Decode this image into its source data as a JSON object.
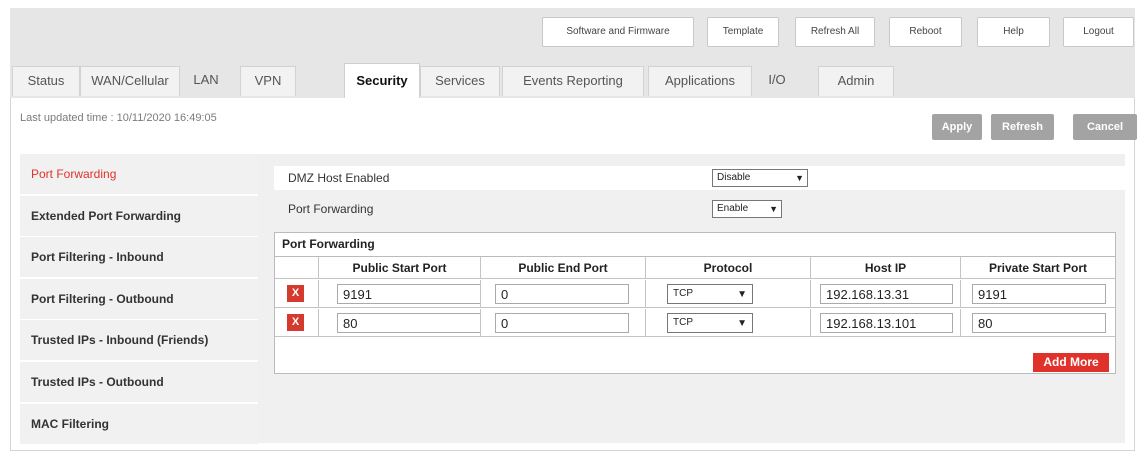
{
  "colors": {
    "accent_red": "#e0322b",
    "delete_red": "#d53a2f",
    "band_gray": "#e6e6e6",
    "panel_gray": "#f0f0f0",
    "action_gray": "#a3a3a3"
  },
  "top_buttons": {
    "software": "Software and Firmware",
    "template": "Template",
    "refresh_all": "Refresh All",
    "reboot": "Reboot",
    "help": "Help",
    "logout": "Logout"
  },
  "tabs": {
    "status": "Status",
    "wan": "WAN/Cellular",
    "lan": "LAN",
    "vpn": "VPN",
    "security": "Security",
    "services": "Services",
    "events": "Events Reporting",
    "applications": "Applications",
    "io": "I/O",
    "admin": "Admin",
    "active": "Security"
  },
  "last_updated": "Last updated time : 10/11/2020 16:49:05",
  "actions": {
    "apply": "Apply",
    "refresh": "Refresh",
    "cancel": "Cancel"
  },
  "sidebar": {
    "items": [
      "Port Forwarding",
      "Extended Port Forwarding",
      "Port Filtering - Inbound",
      "Port Filtering - Outbound",
      "Trusted IPs - Inbound (Friends)",
      "Trusted IPs - Outbound",
      "MAC Filtering"
    ],
    "active": "Port Forwarding"
  },
  "settings": {
    "dmz_label": "DMZ Host Enabled",
    "dmz_value": "Disable",
    "pf_label": "Port Forwarding",
    "pf_value": "Enable"
  },
  "port_forwarding": {
    "title": "Port Forwarding",
    "columns": [
      "Public Start Port",
      "Public End Port",
      "Protocol",
      "Host IP",
      "Private Start Port"
    ],
    "rows": [
      {
        "delete": "X",
        "public_start": "9191",
        "public_end": "0",
        "protocol": "TCP",
        "host_ip": "192.168.13.31",
        "private_start": "9191"
      },
      {
        "delete": "X",
        "public_start": "80",
        "public_end": "0",
        "protocol": "TCP",
        "host_ip": "192.168.13.101",
        "private_start": "80"
      }
    ],
    "add_more": "Add More"
  },
  "icons": {
    "dropdown": "chevron-down-icon",
    "delete": "delete-x-icon"
  }
}
